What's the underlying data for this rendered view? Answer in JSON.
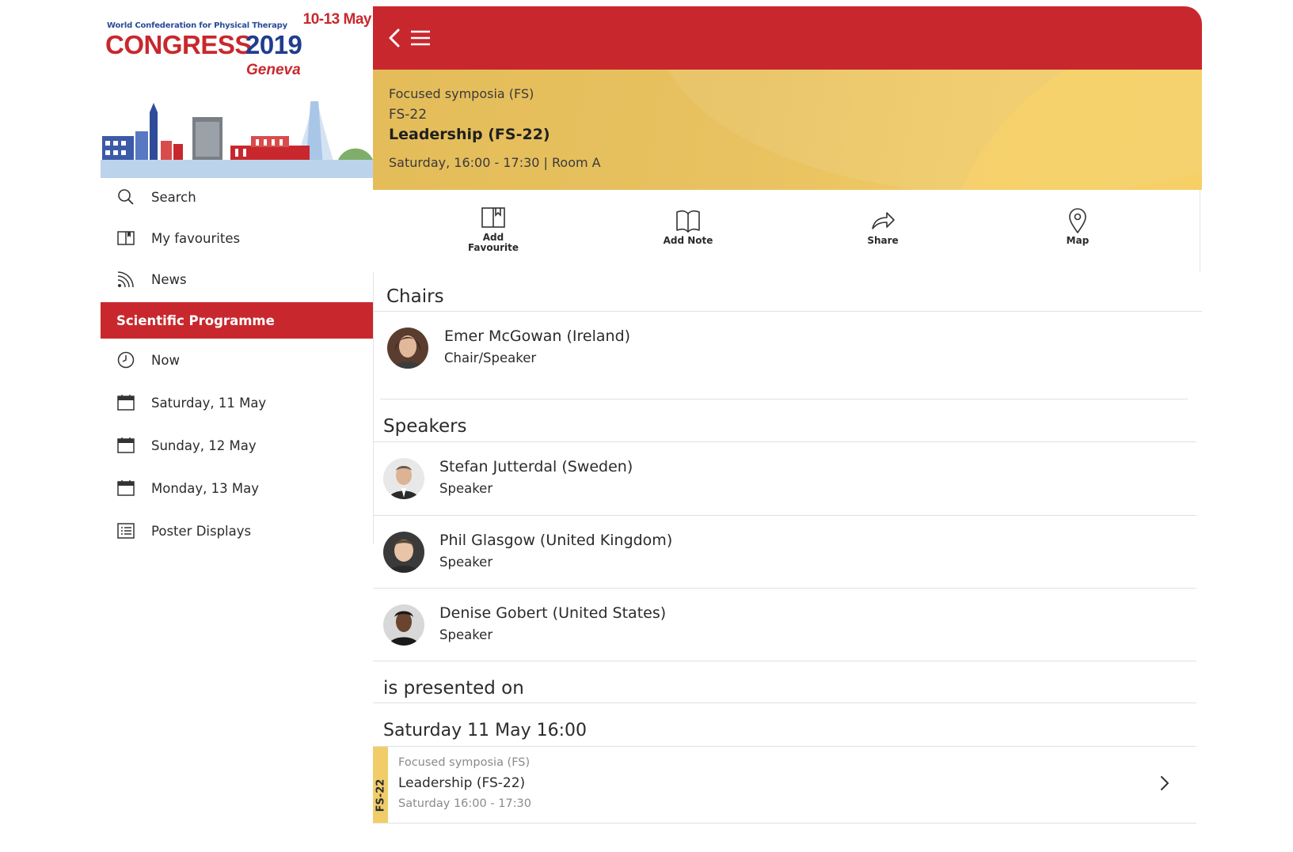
{
  "banner": {
    "subtitle": "World Confederation for Physical Therapy",
    "dates": "10-13 May",
    "title_word": "CONGRESS",
    "title_year": "2019",
    "city": "Geneva"
  },
  "sidebar": {
    "items": [
      {
        "label": "Search",
        "icon": "search-icon"
      },
      {
        "label": "My favourites",
        "icon": "book-icon"
      },
      {
        "label": "News",
        "icon": "rss-icon"
      },
      {
        "label": "Scientific Programme",
        "active": true
      },
      {
        "label": "Now",
        "icon": "clock-icon"
      },
      {
        "label": "Saturday, 11 May",
        "icon": "calendar-icon"
      },
      {
        "label": "Sunday, 12 May",
        "icon": "calendar-icon"
      },
      {
        "label": "Monday, 13 May",
        "icon": "calendar-icon"
      },
      {
        "label": "Poster Displays",
        "icon": "list-icon"
      }
    ]
  },
  "header": {
    "category": "Focused symposia (FS)",
    "code": "FS-22",
    "title": "Leadership (FS-22)",
    "when_where": "Saturday, 16:00 - 17:30 | Room A"
  },
  "actions": [
    {
      "label_line1": "Add",
      "label_line2": "Favourite",
      "icon": "add-favourite-icon"
    },
    {
      "label_line1": "Add Note",
      "label_line2": "",
      "icon": "add-note-icon"
    },
    {
      "label_line1": "Share",
      "label_line2": "",
      "icon": "share-icon"
    },
    {
      "label_line1": "Map",
      "label_line2": "",
      "icon": "map-pin-icon"
    }
  ],
  "chairs": {
    "heading": "Chairs",
    "people": [
      {
        "name": "Emer McGowan (Ireland)",
        "role": "Chair/Speaker"
      }
    ]
  },
  "speakers": {
    "heading": "Speakers",
    "people": [
      {
        "name": "Stefan Jutterdal (Sweden)",
        "role": "Speaker"
      },
      {
        "name": "Phil Glasgow (United Kingdom)",
        "role": "Speaker"
      },
      {
        "name": "Denise Gobert (United States)",
        "role": "Speaker"
      }
    ]
  },
  "presented": {
    "heading": "is presented on",
    "date_heading": "Saturday 11 May 16:00",
    "session": {
      "tag": "FS-22",
      "category": "Focused symposia (FS)",
      "title": "Leadership (FS-22)",
      "time": "Saturday 16:00 - 17:30"
    }
  },
  "colors": {
    "brand_red": "#c8282d",
    "header_gold": "#e8c260",
    "stripe_gold": "#f1cd69"
  }
}
